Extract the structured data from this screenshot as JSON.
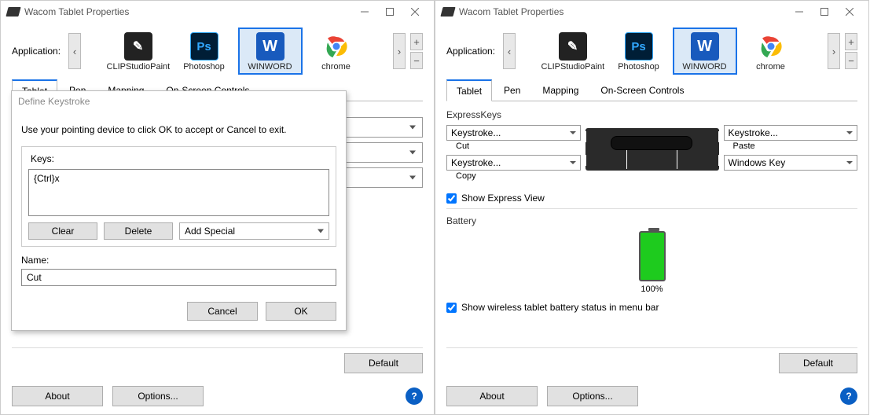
{
  "window": {
    "title": "Wacom Tablet Properties"
  },
  "approw": {
    "label": "Application:",
    "apps": [
      {
        "label": "CLIPStudioPaint"
      },
      {
        "label": "Photoshop"
      },
      {
        "label": "WINWORD"
      },
      {
        "label": "chrome"
      }
    ]
  },
  "tabs": [
    "Tablet",
    "Pen",
    "Mapping",
    "On-Screen Controls"
  ],
  "dialog": {
    "title": "Define Keystroke",
    "message": "Use your pointing device to click OK to accept or Cancel to exit.",
    "keys_label": "Keys:",
    "keys_value": "{Ctrl}x",
    "clear": "Clear",
    "delete": "Delete",
    "add_special": "Add Special",
    "name_label": "Name:",
    "name_value": "Cut",
    "cancel": "Cancel",
    "ok": "OK"
  },
  "buttons": {
    "default": "Default",
    "about": "About",
    "options": "Options..."
  },
  "right": {
    "section": "ExpressKeys",
    "keys": [
      {
        "mode": "Keystroke...",
        "name": "Cut"
      },
      {
        "mode": "Keystroke...",
        "name": "Copy"
      },
      {
        "mode": "Keystroke...",
        "name": "Paste"
      },
      {
        "mode": "Windows Key",
        "name": ""
      }
    ],
    "show_express": "Show Express View",
    "battery_label": "Battery",
    "battery_pct": "100%",
    "show_battery": "Show wireless tablet battery status in menu bar"
  }
}
